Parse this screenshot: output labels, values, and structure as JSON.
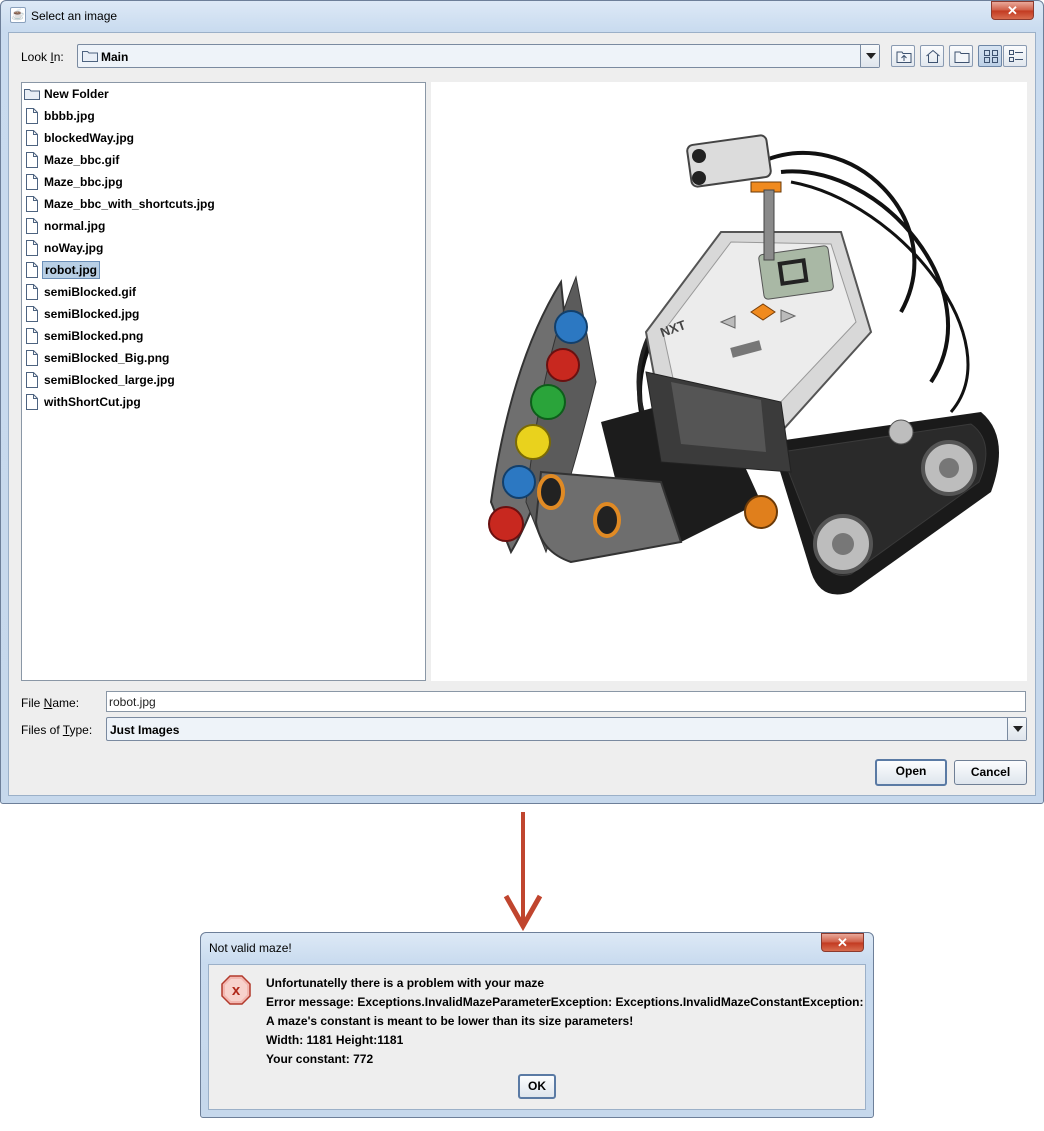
{
  "chooser": {
    "title": "Select an image",
    "look_in_label_pre": "Look ",
    "look_in_label_u": "I",
    "look_in_label_post": "n:",
    "look_in_value": "Main",
    "files": [
      {
        "name": "New Folder",
        "type": "folder"
      },
      {
        "name": "bbbb.jpg",
        "type": "file"
      },
      {
        "name": "blockedWay.jpg",
        "type": "file"
      },
      {
        "name": "Maze_bbc.gif",
        "type": "file"
      },
      {
        "name": "Maze_bbc.jpg",
        "type": "file"
      },
      {
        "name": "Maze_bbc_with_shortcuts.jpg",
        "type": "file"
      },
      {
        "name": "normal.jpg",
        "type": "file"
      },
      {
        "name": "noWay.jpg",
        "type": "file"
      },
      {
        "name": "robot.jpg",
        "type": "file",
        "selected": true
      },
      {
        "name": "semiBlocked.gif",
        "type": "file"
      },
      {
        "name": "semiBlocked.jpg",
        "type": "file"
      },
      {
        "name": "semiBlocked.png",
        "type": "file"
      },
      {
        "name": "semiBlocked_Big.png",
        "type": "file"
      },
      {
        "name": "semiBlocked_large.jpg",
        "type": "file"
      },
      {
        "name": "withShortCut.jpg",
        "type": "file"
      }
    ],
    "file_name_label_pre": "File ",
    "file_name_label_u": "N",
    "file_name_label_post": "ame:",
    "file_name_value": "robot.jpg",
    "files_of_type_label_pre": "Files of ",
    "files_of_type_label_u": "T",
    "files_of_type_label_post": "ype:",
    "files_of_type_value": "Just Images",
    "open_label": "Open",
    "cancel_label": "Cancel",
    "preview_logo_text": "NXT"
  },
  "dialog": {
    "title": "Not valid maze!",
    "lines": [
      "Unfortunatelly there is a problem with your maze",
      "Error message: Exceptions.InvalidMazeParameterException: Exceptions.InvalidMazeConstantException:",
      "A maze's constant is meant to be lower than its size parameters!",
      "Width: 1181 Height:1181",
      "Your constant: 772"
    ],
    "ok_label": "OK",
    "error_icon_text": "x"
  },
  "colors": {
    "accent": "#c0452e",
    "selection": "#b8cfe5"
  }
}
